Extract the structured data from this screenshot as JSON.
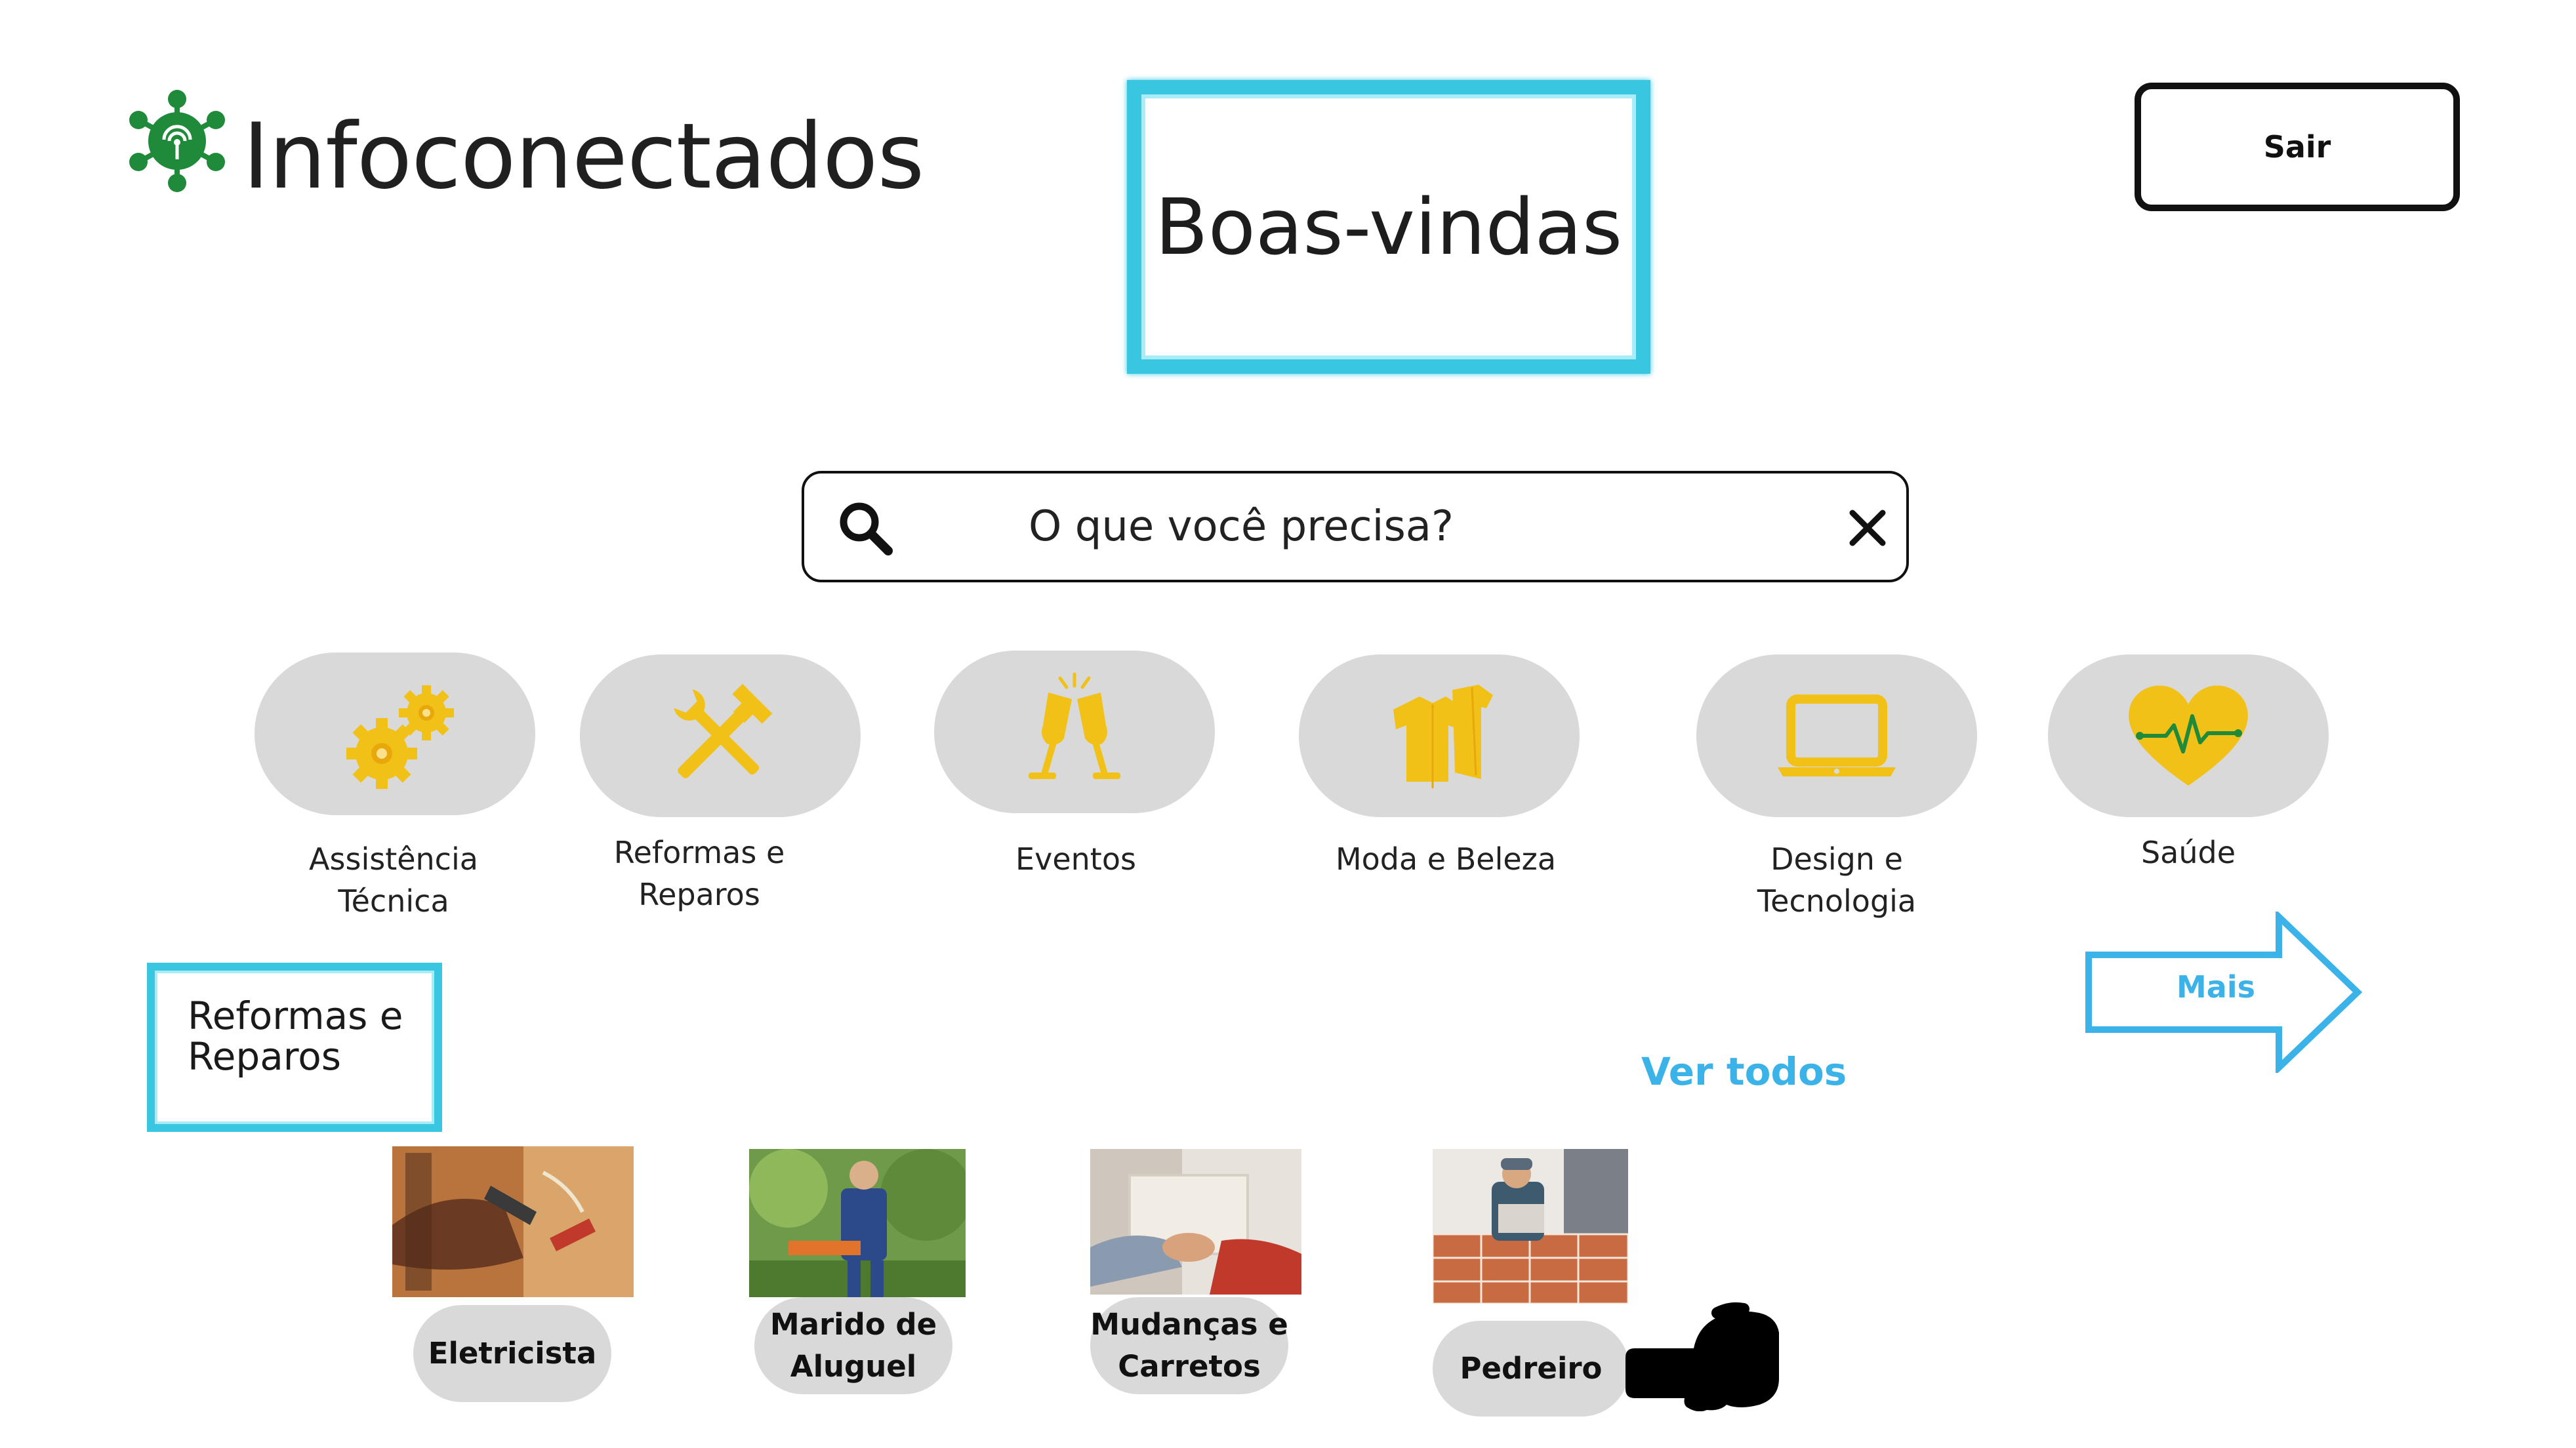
{
  "header": {
    "app_title": "Infoconectados",
    "welcome": "Boas-vindas",
    "logout_label": "Sair"
  },
  "search": {
    "placeholder": "O que você precisa?"
  },
  "categories": [
    {
      "label": "Assistência Técnica",
      "icon": "gears-icon"
    },
    {
      "label": "Reformas e Reparos",
      "icon": "hammer-wrench-icon"
    },
    {
      "label": "Eventos",
      "icon": "champagne-toast-icon"
    },
    {
      "label": "Moda e Beleza",
      "icon": "clothes-icon"
    },
    {
      "label": "Design e Tecnologia",
      "icon": "laptop-icon"
    },
    {
      "label": "Saúde",
      "icon": "heartbeat-icon"
    }
  ],
  "more_label": "Mais",
  "section": {
    "title": "Reformas e Reparos",
    "see_all": "Ver todos",
    "services": [
      {
        "label": "Eletricista"
      },
      {
        "label": "Marido de Aluguel"
      },
      {
        "label": "Mudanças e Carretos"
      },
      {
        "label": "Pedreiro"
      }
    ]
  },
  "colors": {
    "accent_cyan": "#38c6e0",
    "link_blue": "#3cb3e8",
    "icon_yellow": "#f2c117",
    "pill_gray": "#d9d9d9",
    "logo_green": "#1f8a3a"
  }
}
